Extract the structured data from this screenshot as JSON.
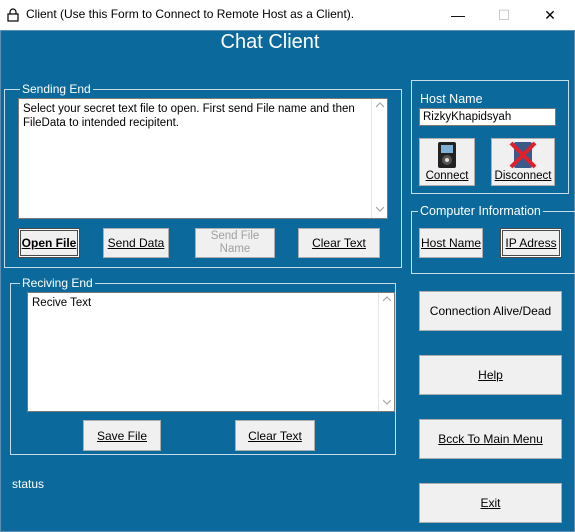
{
  "window": {
    "title": "Client (Use this Form to Connect to Remote Host as a Client).",
    "minimize_glyph": "—",
    "maximize_glyph": "☐",
    "close_glyph": "✕"
  },
  "heading": "Chat Client",
  "sending": {
    "group_label": "Sending End",
    "text": "Select your secret text file to open. First send File name and then FileData to intended recipitent.",
    "buttons": {
      "open_file": "Open File",
      "send_data": "Send Data",
      "send_file_name": "Send File Name",
      "clear_text": "Clear Text"
    }
  },
  "receiving": {
    "group_label": "Reciving End",
    "text": "Recive Text",
    "buttons": {
      "save_file": "Save File",
      "clear_text": "Clear Text"
    }
  },
  "status_text": "status",
  "host": {
    "label": "Host Name",
    "value": "RizkyKhapidsyah",
    "connect": "Connect",
    "disconnect": "Disconnect"
  },
  "computer_info": {
    "group_label": "Computer Information",
    "host_name": "Host Name",
    "ip_address": "IP Adress"
  },
  "actions": {
    "connection_alive": "Connection Alive/Dead",
    "help": "Help",
    "back_to_main": "Bcck To Main Menu",
    "exit": "Exit"
  },
  "colors": {
    "form_background": "#0b6a9b",
    "button_face": "#f0f0f0",
    "disconnect_cross": "#e0202a"
  }
}
